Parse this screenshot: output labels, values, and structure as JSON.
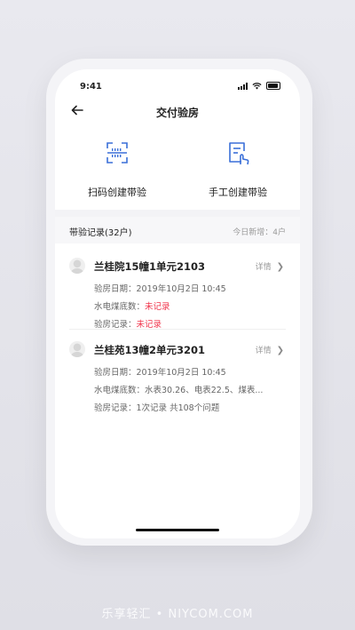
{
  "status": {
    "time": "9:41"
  },
  "nav": {
    "title": "交付验房"
  },
  "actions": {
    "scan_label": "扫码创建带验",
    "manual_label": "手工创建带验"
  },
  "records": {
    "title": "带验记录(32户)",
    "today_new": "今日新增：4户"
  },
  "cards": [
    {
      "title": "兰桂院15幢1单元2103",
      "detail": "详情",
      "rows": [
        {
          "label": "验房日期：",
          "value": "2019年10月2日  10:45",
          "highlight": false
        },
        {
          "label": "水电煤底数：",
          "value": "未记录",
          "highlight": true
        },
        {
          "label": "验房记录：",
          "value": "未记录",
          "highlight": true
        }
      ]
    },
    {
      "title": "兰桂苑13幢2单元3201",
      "detail": "详情",
      "rows": [
        {
          "label": "验房日期：",
          "value": "2019年10月2日  10:45",
          "highlight": false
        },
        {
          "label": "水电煤底数：",
          "value": "水表30.26、电表22.5、煤表...",
          "highlight": false
        },
        {
          "label": "验房记录：",
          "value": "1次记录 共108个问题",
          "highlight": false
        }
      ]
    }
  ],
  "watermark": "乐享轻汇 • NIYCOM.COM",
  "colors": {
    "accent": "#3a6fd8",
    "warning": "#f0344b",
    "muted": "#9a9a9a"
  },
  "icons": {
    "back": "arrow-left-icon",
    "scan": "scan-qr-icon",
    "manual": "manual-edit-icon",
    "chevron": "chevron-right-icon",
    "avatar": "user-avatar-icon"
  }
}
